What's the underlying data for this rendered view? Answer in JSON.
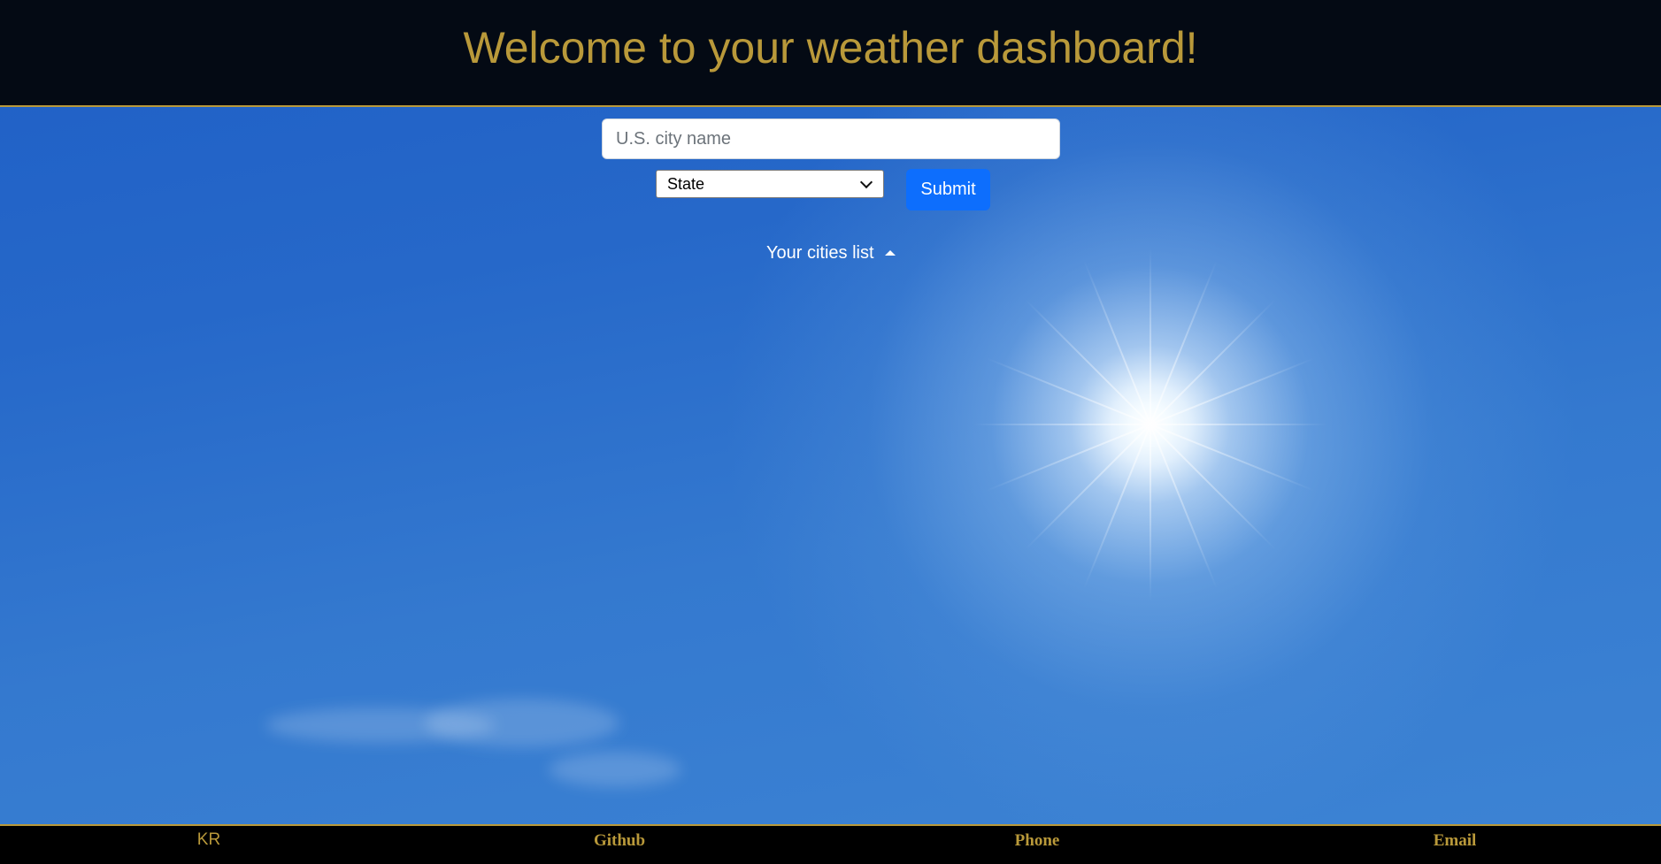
{
  "header": {
    "title": "Welcome to your weather dashboard!"
  },
  "search": {
    "city_placeholder": "U.S. city name",
    "state_selected": "State",
    "submit_label": "Submit"
  },
  "cities": {
    "toggle_label": "Your cities list"
  },
  "footer": {
    "initials": "KR",
    "links": [
      "Github",
      "Phone",
      "Email"
    ]
  },
  "colors": {
    "header_background": "#040a14",
    "accent_gold": "#b9993a",
    "submit_blue": "#0d6efd",
    "sky_blue": "#2668c9"
  },
  "icons": {
    "dropdown": "chevron-down-icon",
    "cities_toggle": "caret-up-icon"
  }
}
